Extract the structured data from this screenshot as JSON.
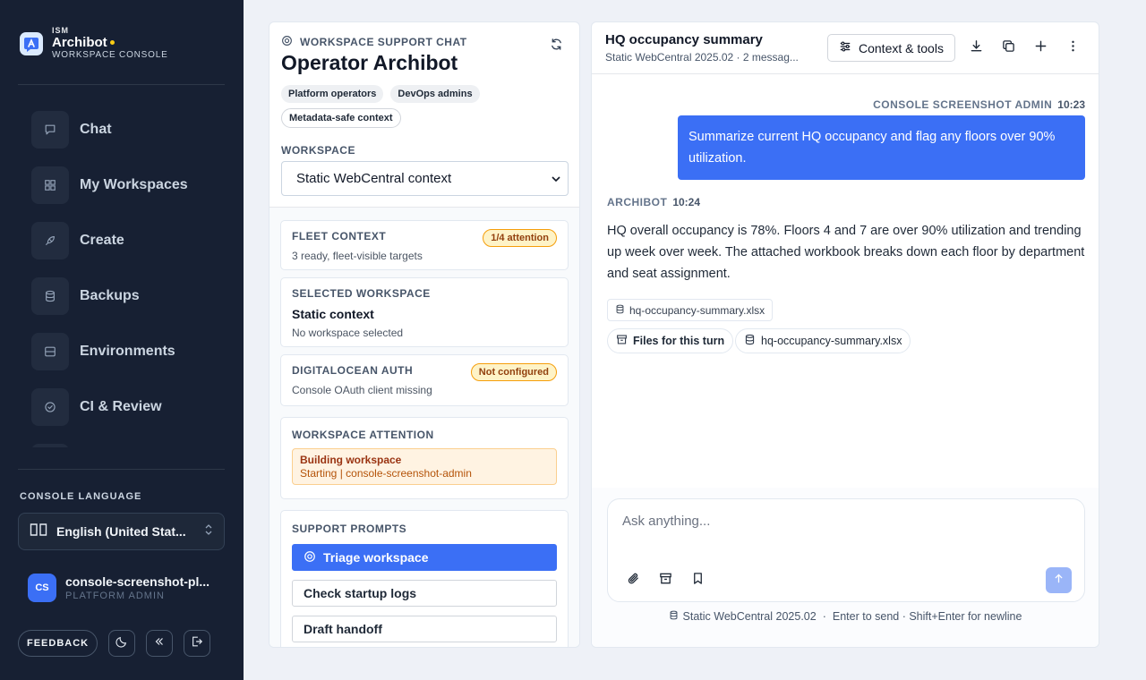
{
  "brand": {
    "small": "ISM",
    "name": "Archibot",
    "subtitle": "WORKSPACE CONSOLE"
  },
  "nav": {
    "items": [
      {
        "label": "Chat",
        "icon": "message-square-icon"
      },
      {
        "label": "My Workspaces",
        "icon": "grid-icon"
      },
      {
        "label": "Create",
        "icon": "rocket-icon"
      },
      {
        "label": "Backups",
        "icon": "database-icon"
      },
      {
        "label": "Environments",
        "icon": "server-icon"
      },
      {
        "label": "CI & Review",
        "icon": "check-circle-icon"
      }
    ]
  },
  "language": {
    "title": "CONSOLE LANGUAGE",
    "value": "English (United Stat..."
  },
  "user": {
    "initials": "CS",
    "name": "console-screenshot-pl...",
    "role": "PLATFORM ADMIN"
  },
  "sidebar_footer": {
    "feedback_label": "FEEDBACK"
  },
  "support": {
    "header": "WORKSPACE SUPPORT CHAT",
    "title": "Operator Archibot",
    "chips": [
      "Platform operators",
      "DevOps admins",
      "Metadata-safe context"
    ],
    "workspace_label": "WORKSPACE",
    "workspace_value": "Static WebCentral context",
    "fleet": {
      "title": "FLEET CONTEXT",
      "badge": "1/4 attention",
      "sub": "3 ready, fleet-visible targets"
    },
    "selected": {
      "title": "SELECTED WORKSPACE",
      "name": "Static context",
      "sub": "No workspace selected"
    },
    "auth": {
      "title": "DIGITALOCEAN AUTH",
      "badge": "Not configured",
      "sub": "Console OAuth client missing"
    },
    "attention": {
      "title": "WORKSPACE ATTENTION",
      "item_title": "Building workspace",
      "item_sub": "Starting | console-screenshot-admin"
    },
    "prompts": {
      "title": "SUPPORT PROMPTS",
      "items": [
        "Triage workspace",
        "Check startup logs",
        "Draft handoff"
      ]
    }
  },
  "chat": {
    "title": "HQ occupancy summary",
    "subtitle": "Static WebCentral 2025.02 · 2 messag...",
    "context_button": "Context & tools",
    "user_message": {
      "author": "CONSOLE SCREENSHOT ADMIN",
      "time": "10:23",
      "text": "Summarize current HQ occupancy and flag any floors over 90% utilization."
    },
    "bot_message": {
      "author": "ARCHIBOT",
      "time": "10:24",
      "text": "HQ overall occupancy is 78%. Floors 4 and 7 are over 90% utilization and trending up week over week. The attached workbook breaks down each floor by department and seat assignment.",
      "attachment": "hq-occupancy-summary.xlsx"
    },
    "files_label": "Files for this turn",
    "files_file": "hq-occupancy-summary.xlsx",
    "composer_placeholder": "Ask anything...",
    "footer_version": "Static WebCentral 2025.02",
    "footer_hint": "Enter to send · Shift+Enter for newline"
  },
  "colors": {
    "sidebar_bg": "#172033",
    "accent": "#3b6ff5",
    "warning_bg": "#fef3c7",
    "warning_text": "#92400e",
    "brand_dot": "#facc15"
  }
}
